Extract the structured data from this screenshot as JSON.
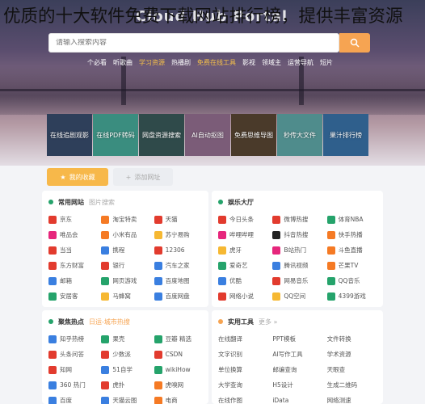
{
  "overlay_caption": "优质的十大软件免费下载网站排行榜，提供丰富资源",
  "header": {
    "site_title": "Cloud Hub Portal"
  },
  "search": {
    "placeholder": "请输入搜索内容"
  },
  "nav": [
    {
      "label": "个必看",
      "active": false
    },
    {
      "label": "听歌曲",
      "active": false
    },
    {
      "label": "学习资源",
      "active": true
    },
    {
      "label": "热播剧",
      "active": false
    },
    {
      "label": "免费在线工具",
      "active": true
    },
    {
      "label": "影视",
      "active": false
    },
    {
      "label": "领域主",
      "active": false
    },
    {
      "label": "运营导航",
      "active": false
    },
    {
      "label": "短片",
      "active": false
    }
  ],
  "tiles": [
    {
      "label": "在线追剧观影",
      "color": "#2e3f5a"
    },
    {
      "label": "在线PDF转码",
      "color": "#3a8d7f"
    },
    {
      "label": "网盘资源搜索",
      "color": "#2f4a4a"
    },
    {
      "label": "AI自动抠图",
      "color": "#7b5c78"
    },
    {
      "label": "免费思维导图",
      "color": "#4a3a2a"
    },
    {
      "label": "秒传大文件",
      "color": "#4f8c8c"
    },
    {
      "label": "果汁排行榜",
      "color": "#2f5f8c"
    }
  ],
  "actions": {
    "fav": "我的收藏",
    "add": "添加网址"
  },
  "panels": {
    "common": {
      "title": "常用网站",
      "sub": "图片搜索",
      "items": [
        {
          "label": "京东",
          "color": "#e23b2e"
        },
        {
          "label": "淘宝特卖",
          "color": "#f57a24"
        },
        {
          "label": "天猫",
          "color": "#e23b2e"
        },
        {
          "label": "唯品会",
          "color": "#e6267c"
        },
        {
          "label": "小米有品",
          "color": "#f57a24"
        },
        {
          "label": "苏宁易购",
          "color": "#f6b832"
        },
        {
          "label": "当当",
          "color": "#e23b2e"
        },
        {
          "label": "携程",
          "color": "#3a7fe0"
        },
        {
          "label": "12306",
          "color": "#e23b2e"
        },
        {
          "label": "东方财富",
          "color": "#e23b2e"
        },
        {
          "label": "银行",
          "color": "#e23b2e"
        },
        {
          "label": "汽车之家",
          "color": "#3a7fe0"
        },
        {
          "label": "邮箱",
          "color": "#3a7fe0"
        },
        {
          "label": "网页游戏",
          "color": "#25a36b"
        },
        {
          "label": "百度地图",
          "color": "#3a7fe0"
        },
        {
          "label": "安居客",
          "color": "#25a36b"
        },
        {
          "label": "马蜂窝",
          "color": "#f6b832"
        },
        {
          "label": "百度网盘",
          "color": "#3a7fe0"
        }
      ]
    },
    "entertain": {
      "title": "娱乐大厅",
      "sub": "",
      "items": [
        {
          "label": "今日头条",
          "color": "#e23b2e"
        },
        {
          "label": "微博热搜",
          "color": "#e23b2e"
        },
        {
          "label": "体育NBA",
          "color": "#25a36b"
        },
        {
          "label": "哔哩哔哩",
          "color": "#e6267c"
        },
        {
          "label": "抖音热搜",
          "color": "#222222"
        },
        {
          "label": "快手热播",
          "color": "#f57a24"
        },
        {
          "label": "虎牙",
          "color": "#f6b832"
        },
        {
          "label": "B站热门",
          "color": "#e6267c"
        },
        {
          "label": "斗鱼直播",
          "color": "#f57a24"
        },
        {
          "label": "爱奇艺",
          "color": "#25a36b"
        },
        {
          "label": "腾讯视频",
          "color": "#3a7fe0"
        },
        {
          "label": "芒果TV",
          "color": "#f57a24"
        },
        {
          "label": "优酷",
          "color": "#3a7fe0"
        },
        {
          "label": "网易音乐",
          "color": "#e23b2e"
        },
        {
          "label": "QQ音乐",
          "color": "#25a36b"
        },
        {
          "label": "网络小说",
          "color": "#e23b2e"
        },
        {
          "label": "QQ空间",
          "color": "#f6b832"
        },
        {
          "label": "4399游戏",
          "color": "#25a36b"
        }
      ]
    },
    "hot": {
      "title": "聚焦热点",
      "sub": "日运-城市热搜",
      "items": [
        {
          "label": "知乎热榜",
          "color": "#3a7fe0"
        },
        {
          "label": "果壳",
          "color": "#25a36b"
        },
        {
          "label": "豆瓣 精选",
          "color": "#25a36b"
        },
        {
          "label": "头条问答",
          "color": "#e23b2e"
        },
        {
          "label": "少数派",
          "color": "#e23b2e"
        },
        {
          "label": "CSDN",
          "color": "#e23b2e"
        },
        {
          "label": "知网",
          "color": "#e23b2e"
        },
        {
          "label": "51自学",
          "color": "#3a7fe0"
        },
        {
          "label": "wikiHow",
          "color": "#25a36b"
        },
        {
          "label": "360 热门",
          "color": "#3a7fe0"
        },
        {
          "label": "虎扑",
          "color": "#e23b2e"
        },
        {
          "label": "虎嗅网",
          "color": "#f57a24"
        },
        {
          "label": "百度",
          "color": "#3a7fe0"
        },
        {
          "label": "天猫云图",
          "color": "#3a7fe0"
        },
        {
          "label": "电商",
          "color": "#f57a24"
        }
      ]
    },
    "tools": {
      "title": "实用工具",
      "sub": "更多 »",
      "items": [
        {
          "label": "在线翻译",
          "color": ""
        },
        {
          "label": "PPT模板",
          "color": ""
        },
        {
          "label": "文件转换",
          "color": ""
        },
        {
          "label": "文字识别",
          "color": ""
        },
        {
          "label": "AI写作工具",
          "color": ""
        },
        {
          "label": "学术资源",
          "color": ""
        },
        {
          "label": "单位换算",
          "color": ""
        },
        {
          "label": "邮编查询",
          "color": ""
        },
        {
          "label": "天眼查",
          "color": ""
        },
        {
          "label": "大学查询",
          "color": ""
        },
        {
          "label": "H5设计",
          "color": ""
        },
        {
          "label": "生成二维码",
          "color": ""
        },
        {
          "label": "在线作图",
          "color": ""
        },
        {
          "label": "iData",
          "color": ""
        },
        {
          "label": "网络测速",
          "color": ""
        }
      ]
    }
  }
}
